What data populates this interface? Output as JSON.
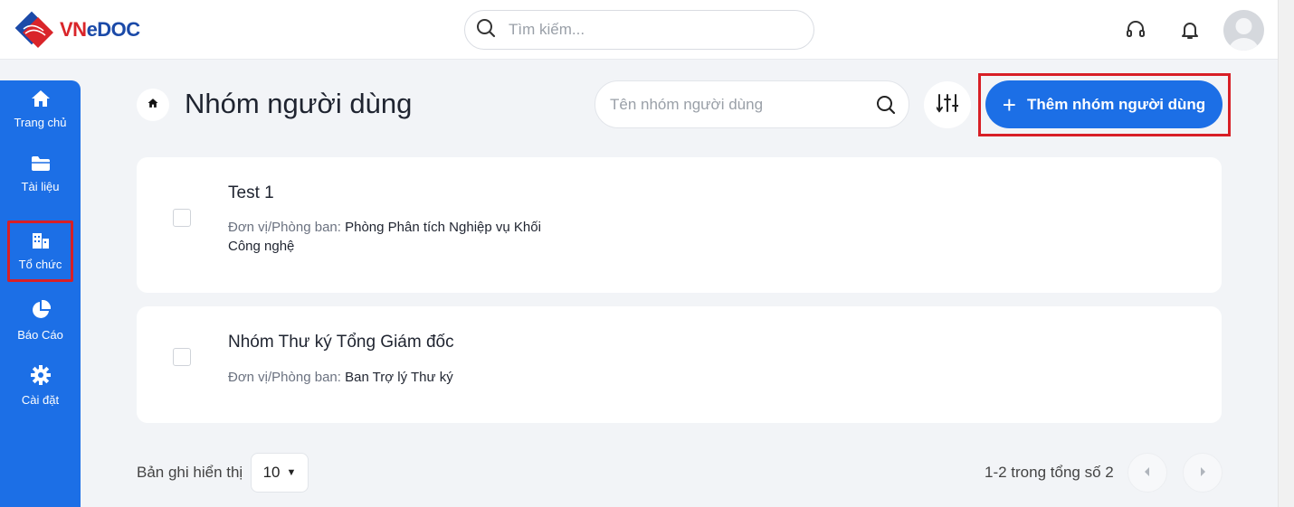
{
  "header": {
    "logo_text_vn": "VN",
    "logo_text_doc": "eDOC",
    "search_placeholder": "Tìm kiếm...",
    "icons": [
      "headset-icon",
      "bell-icon",
      "avatar"
    ]
  },
  "sidebar": {
    "items": [
      {
        "label": "Trang chủ",
        "icon": "home-icon"
      },
      {
        "label": "Tài liệu",
        "icon": "folder-icon"
      },
      {
        "label": "Tổ chức",
        "icon": "building-icon",
        "highlighted": true
      },
      {
        "label": "Báo Cáo",
        "icon": "pie-chart-icon"
      },
      {
        "label": "Cài đặt",
        "icon": "gear-icon"
      }
    ]
  },
  "page": {
    "title": "Nhóm người dùng",
    "filter_placeholder": "Tên nhóm người dùng",
    "add_button_label": "Thêm nhóm người dùng"
  },
  "groups": [
    {
      "name": "Test 1",
      "dept_label": "Đơn vị/Phòng ban:",
      "dept_value_line1": "Phòng Phân tích Nghiệp vụ Khối",
      "dept_value_line2": "Công nghệ"
    },
    {
      "name": "Nhóm Thư ký Tổng Giám đốc",
      "dept_label": "Đơn vị/Phòng ban:",
      "dept_value_line1": "Ban Trợ lý Thư ký",
      "dept_value_line2": ""
    }
  ],
  "footer": {
    "page_size_label": "Bản ghi hiển thị",
    "page_size_value": "10",
    "page_info": "1-2 trong tổng số 2"
  },
  "colors": {
    "primary": "#1c6fe6",
    "highlight": "#d81f26"
  }
}
